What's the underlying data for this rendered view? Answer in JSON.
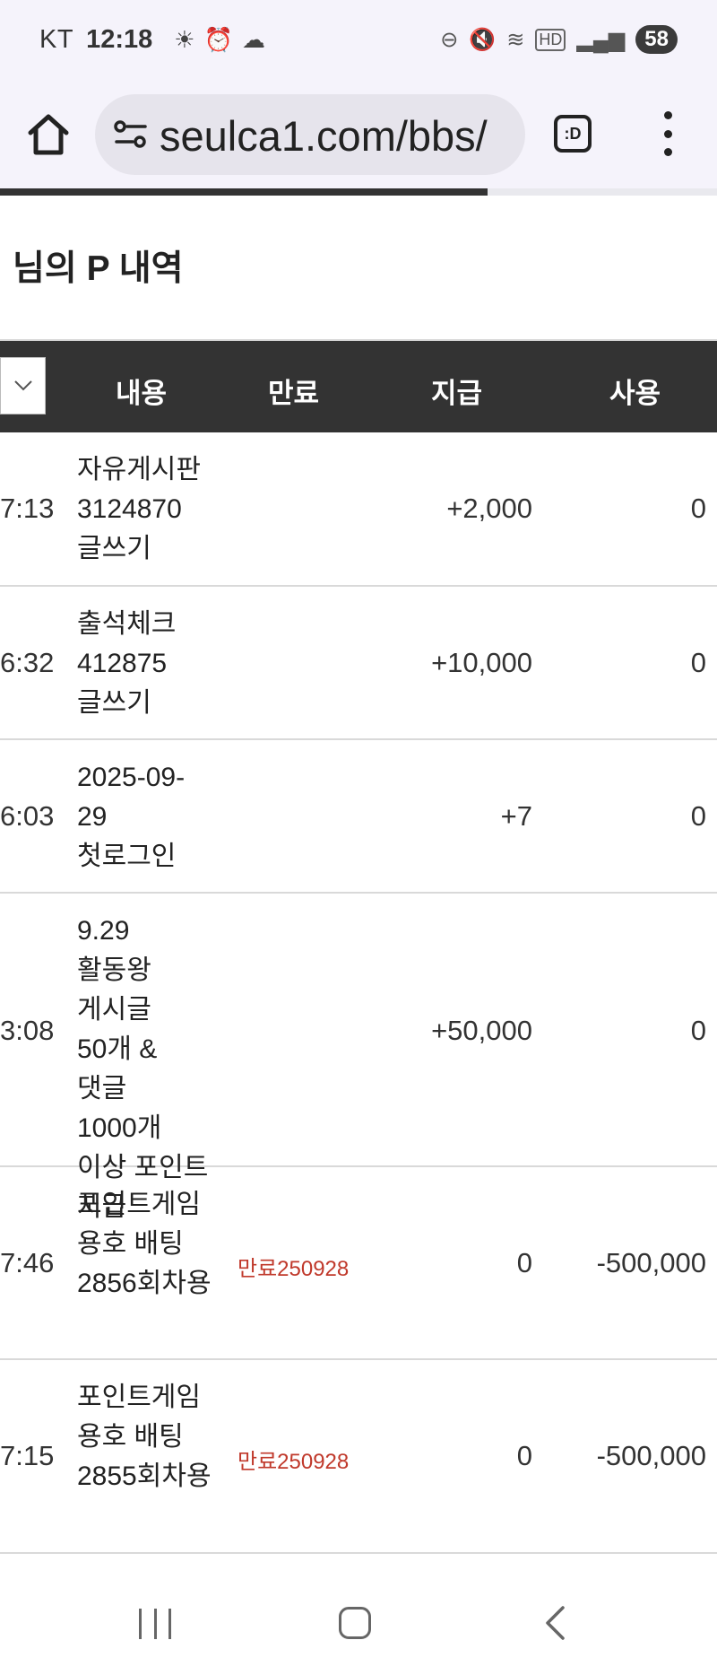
{
  "status_bar": {
    "carrier": "KT",
    "time": "12:18",
    "battery": "58"
  },
  "browser": {
    "url": "seulca1.com/bbs/",
    "tab_switcher_label": ":D",
    "progress": 0.68
  },
  "page": {
    "title": "님의 P 내역"
  },
  "table": {
    "headers": {
      "content": "내용",
      "expire": "만료",
      "give": "지급",
      "use": "사용"
    },
    "rows": [
      {
        "time": "7:13",
        "content": "자유게시판 3124870 글쓰기",
        "expire": "",
        "give": "+2,000",
        "use": "0"
      },
      {
        "time": "6:32",
        "content": "출석체크 412875 글쓰기",
        "expire": "",
        "give": "+10,000",
        "use": "0"
      },
      {
        "time": "6:03",
        "content": "2025-09-29 첫로그인",
        "expire": "",
        "give": "+7",
        "use": "0"
      },
      {
        "time": "3:08",
        "content": "9.29 활동왕 게시글 50개 & 댓글 1000개 이상 포인트 지급",
        "expire": "",
        "give": "+50,000",
        "use": "0"
      },
      {
        "time": "7:46",
        "content": "포인트게임 용호 배팅 2856회차용",
        "expire": "만료250928",
        "give": "0",
        "use": "-500,000"
      },
      {
        "time": "7:15",
        "content": "포인트게임 용호 배팅 2855회차용",
        "expire": "만료250928",
        "give": "0",
        "use": "-500,000"
      }
    ]
  },
  "colors": {
    "header_bg": "#333333",
    "expire_red": "#c0392b",
    "chrome_bg": "#f5f3fb"
  }
}
